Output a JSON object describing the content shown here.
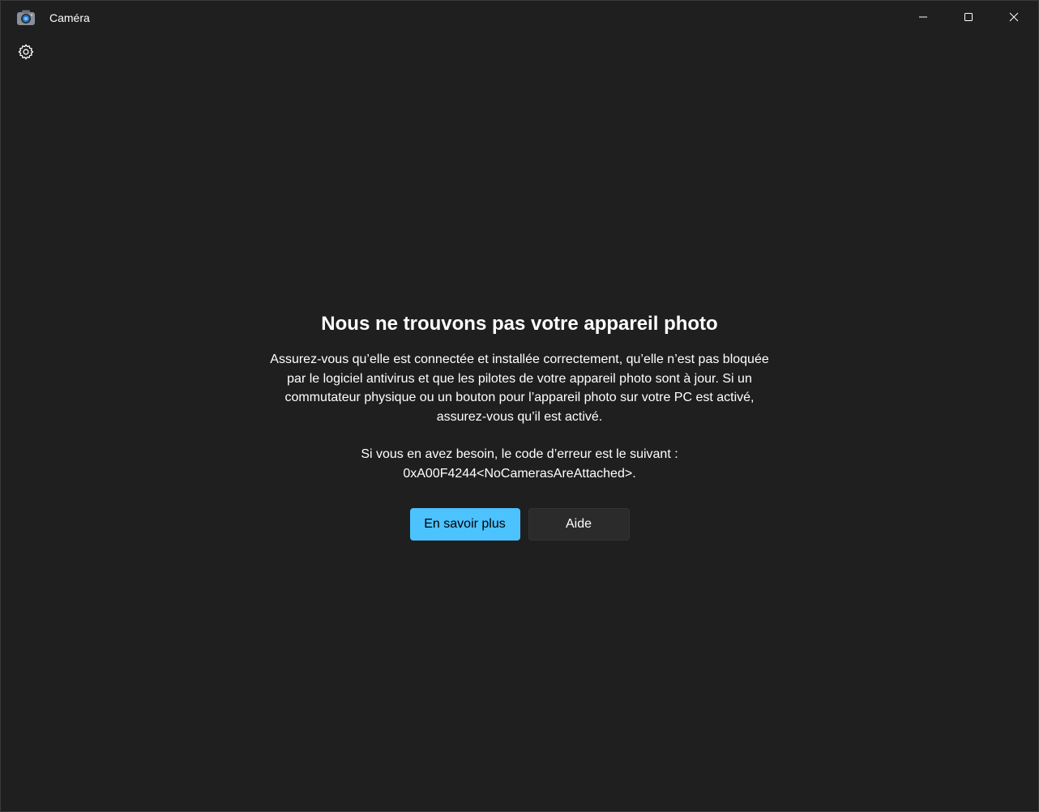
{
  "window": {
    "title": "Caméra"
  },
  "icons": {
    "app": "camera-icon",
    "minimize": "minimize-icon",
    "maximize": "maximize-icon",
    "close": "close-icon",
    "settings": "gear-icon"
  },
  "message": {
    "heading": "Nous ne trouvons pas votre appareil photo",
    "body": "Assurez-vous qu’elle est connectée et installée correctement, qu’elle n’est pas bloquée par le logiciel antivirus et que les pilotes de votre appareil photo sont à jour. Si un commutateur physique ou un bouton pour l’appareil photo sur votre PC est activé, assurez-vous qu’il est activé.",
    "error_line1": "Si vous en avez besoin, le code d’erreur est le suivant :",
    "error_line2": "0xA00F4244<NoCamerasAreAttached>."
  },
  "buttons": {
    "learn_more": "En savoir plus",
    "help": "Aide"
  },
  "colors": {
    "background": "#1f1f1f",
    "accent": "#4cc2ff",
    "secondary_button": "#2b2b2b"
  }
}
